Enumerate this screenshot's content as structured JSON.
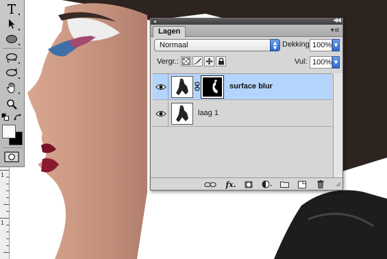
{
  "layers_panel": {
    "tab_label": "Lagen",
    "blend_mode": "Normaal",
    "opacity_label": "Dekking:",
    "opacity_value": "100%",
    "lock_label": "Vergr.:",
    "fill_label": "Vul:",
    "fill_value": "100%",
    "layers": [
      {
        "name": "surface blur",
        "selected": true,
        "visible": true,
        "has_mask": true
      },
      {
        "name": "laag 1",
        "selected": false,
        "visible": true,
        "has_mask": false
      }
    ],
    "footer_icons": [
      "link-layers-icon",
      "layer-style-fx-icon",
      "add-mask-icon",
      "adjustment-layer-icon",
      "new-group-icon",
      "new-layer-icon",
      "delete-layer-icon"
    ]
  },
  "tools": [
    "type-tool-icon",
    "path-selection-icon",
    "ellipse-shape-icon",
    "lasso-tool-icon",
    "rotate-view-icon",
    "hand-tool-icon",
    "zoom-tool-icon",
    "default-colors-icon",
    "swap-colors-icon",
    "color-swatches",
    "quick-mask-icon"
  ],
  "ruler": {
    "numbers": [
      "1",
      "1"
    ]
  },
  "colors": {
    "selection": "#b3d4fc",
    "panel_bg": "#d6d6d6",
    "accent_blue": "#2d67c9"
  }
}
